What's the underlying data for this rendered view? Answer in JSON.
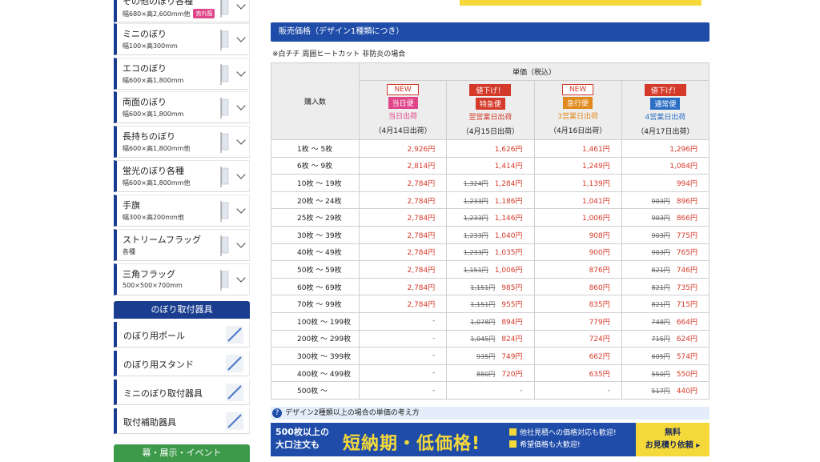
{
  "sidebar": {
    "items": [
      {
        "name": "その他のぼり各種",
        "size": "幅680×高2,600mm他",
        "badge": "売れ筋"
      },
      {
        "name": "ミニのぼり",
        "size": "幅100×高300mm",
        "badge": ""
      },
      {
        "name": "エコのぼり",
        "size": "幅600×高1,800mm",
        "badge": ""
      },
      {
        "name": "両面のぼり",
        "size": "幅600×高1,800mm",
        "badge": ""
      },
      {
        "name": "長持ちのぼり",
        "size": "幅600×高1,800mm他",
        "badge": ""
      },
      {
        "name": "蛍光のぼり各種",
        "size": "幅600×高1,800mm他",
        "badge": ""
      },
      {
        "name": "手旗",
        "size": "幅300×高200mm他",
        "badge": ""
      },
      {
        "name": "ストリームフラッグ",
        "size": "各種",
        "badge": ""
      },
      {
        "name": "三角フラッグ",
        "size": "500×500×700mm",
        "badge": ""
      }
    ],
    "section_accessories": "のぼり取付器具",
    "accessories": [
      "のぼり用ポール",
      "のぼり用スタンド",
      "ミニのぼり取付器具",
      "取付補助器具"
    ],
    "section_event": "幕・展示・イベント"
  },
  "main": {
    "title": "販売価格（デザイン1種類につき）",
    "note": "※白チチ 周囲ヒートカット 非防炎の場合",
    "table": {
      "qty_header": "購入数",
      "unit_header": "単価（税込）",
      "options": [
        {
          "tag": "NEW",
          "service": "当日便",
          "ship": "当日出荷",
          "date": "（4月14日出荷）"
        },
        {
          "tag": "値下げ！",
          "service": "特急便",
          "ship": "翌営業日出荷",
          "date": "（4月15日出荷）"
        },
        {
          "tag": "NEW",
          "service": "急行便",
          "ship": "3営業日出荷",
          "date": "（4月16日出荷）"
        },
        {
          "tag": "値下げ！",
          "service": "通常便",
          "ship": "4営業日出荷",
          "date": "（4月17日出荷）"
        }
      ],
      "rows": [
        {
          "qty": "1枚 〜 5枚",
          "prices": [
            [
              "",
              "2,926円"
            ],
            [
              "",
              "1,626円"
            ],
            [
              "",
              "1,461円"
            ],
            [
              "",
              "1,296円"
            ]
          ]
        },
        {
          "qty": "6枚 〜 9枚",
          "prices": [
            [
              "",
              "2,814円"
            ],
            [
              "",
              "1,414円"
            ],
            [
              "",
              "1,249円"
            ],
            [
              "",
              "1,084円"
            ]
          ]
        },
        {
          "qty": "10枚 〜 19枚",
          "prices": [
            [
              "",
              "2,784円"
            ],
            [
              "1,324円",
              "1,284円"
            ],
            [
              "",
              "1,139円"
            ],
            [
              "",
              "994円"
            ]
          ]
        },
        {
          "qty": "20枚 〜 24枚",
          "prices": [
            [
              "",
              "2,784円"
            ],
            [
              "1,233円",
              "1,186円"
            ],
            [
              "",
              "1,041円"
            ],
            [
              "903円",
              "896円"
            ]
          ]
        },
        {
          "qty": "25枚 〜 29枚",
          "prices": [
            [
              "",
              "2,784円"
            ],
            [
              "1,233円",
              "1,146円"
            ],
            [
              "",
              "1,006円"
            ],
            [
              "903円",
              "866円"
            ]
          ]
        },
        {
          "qty": "30枚 〜 39枚",
          "prices": [
            [
              "",
              "2,784円"
            ],
            [
              "1,233円",
              "1,040円"
            ],
            [
              "",
              "908円"
            ],
            [
              "903円",
              "775円"
            ]
          ]
        },
        {
          "qty": "40枚 〜 49枚",
          "prices": [
            [
              "",
              "2,784円"
            ],
            [
              "1,233円",
              "1,035円"
            ],
            [
              "",
              "900円"
            ],
            [
              "903円",
              "765円"
            ]
          ]
        },
        {
          "qty": "50枚 〜 59枚",
          "prices": [
            [
              "",
              "2,784円"
            ],
            [
              "1,151円",
              "1,006円"
            ],
            [
              "",
              "876円"
            ],
            [
              "821円",
              "746円"
            ]
          ]
        },
        {
          "qty": "60枚 〜 69枚",
          "prices": [
            [
              "",
              "2,784円"
            ],
            [
              "1,151円",
              "985円"
            ],
            [
              "",
              "860円"
            ],
            [
              "821円",
              "735円"
            ]
          ]
        },
        {
          "qty": "70枚 〜 99枚",
          "prices": [
            [
              "",
              "2,784円"
            ],
            [
              "1,151円",
              "955円"
            ],
            [
              "",
              "835円"
            ],
            [
              "821円",
              "715円"
            ]
          ]
        },
        {
          "qty": "100枚 〜 199枚",
          "prices": [
            [
              "",
              "-"
            ],
            [
              "1,078円",
              "894円"
            ],
            [
              "",
              "779円"
            ],
            [
              "748円",
              "664円"
            ]
          ]
        },
        {
          "qty": "200枚 〜 299枚",
          "prices": [
            [
              "",
              "-"
            ],
            [
              "1,045円",
              "824円"
            ],
            [
              "",
              "724円"
            ],
            [
              "715円",
              "624円"
            ]
          ]
        },
        {
          "qty": "300枚 〜 399枚",
          "prices": [
            [
              "",
              "-"
            ],
            [
              "935円",
              "749円"
            ],
            [
              "",
              "662円"
            ],
            [
              "605円",
              "574円"
            ]
          ]
        },
        {
          "qty": "400枚 〜 499枚",
          "prices": [
            [
              "",
              "-"
            ],
            [
              "880円",
              "720円"
            ],
            [
              "",
              "635円"
            ],
            [
              "550円",
              "550円"
            ]
          ]
        },
        {
          "qty": "500枚 〜",
          "prices": [
            [
              "",
              "-"
            ],
            [
              "",
              "-"
            ],
            [
              "",
              "-"
            ],
            [
              "517円",
              "440円"
            ]
          ]
        }
      ]
    },
    "faq": "デザイン2種類以上の場合の単価の考え方",
    "cta": {
      "line1": "500枚以上の",
      "line2": "大口注文も",
      "headline": "短納期・低価格!",
      "check1": "他社見積への価格対応も歓迎!",
      "check2": "希望価格も大歓迎!",
      "btn_line1": "無料",
      "btn_line2": "お見積り依頼 ▸"
    }
  },
  "colors": {
    "brand_blue": "#1e4ca8",
    "sidebar_navy": "#1a3d8f",
    "price_red": "#d43a2a",
    "same_day": "#e0458a",
    "express": "#d43a2a",
    "rapid": "#e08a1e",
    "normal": "#2a6fc4",
    "event_green": "#3c9a4a",
    "cta_yellow": "#f5d93a"
  }
}
